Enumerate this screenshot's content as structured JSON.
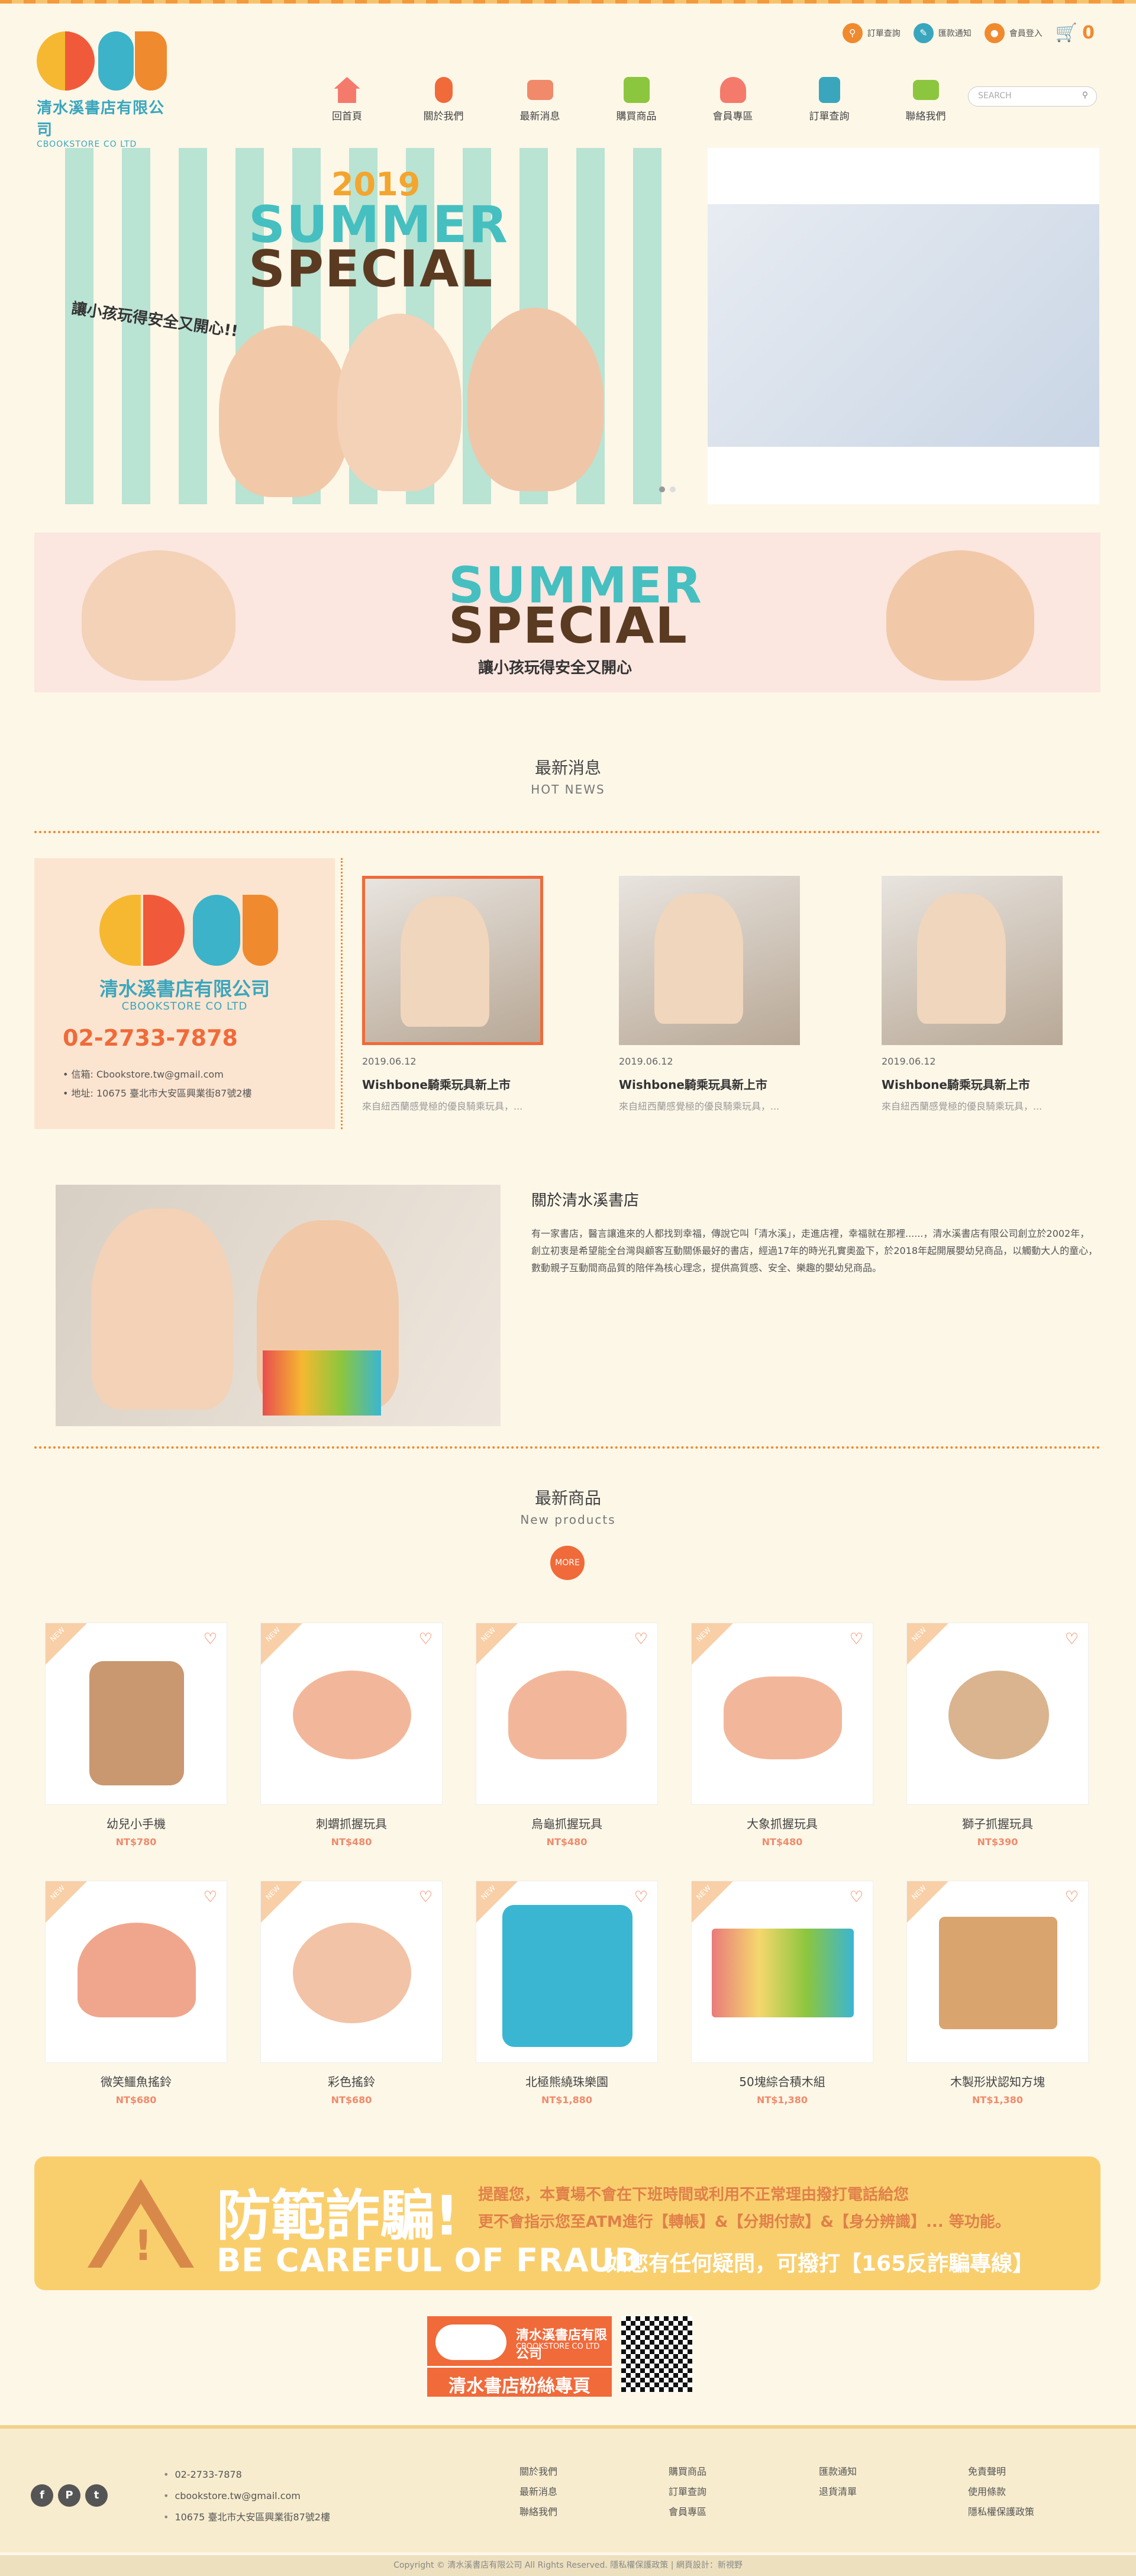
{
  "header": {
    "logo_cn": "清水溪書店有限公司",
    "logo_en": "CBOOKSTORE CO LTD",
    "utility": [
      {
        "label": "訂單查詢",
        "icon": "search-icon",
        "color": "#f08a2e"
      },
      {
        "label": "匯款通知",
        "icon": "edit-icon",
        "color": "#3aa6be"
      },
      {
        "label": "會員登入",
        "icon": "lock-icon",
        "color": "#f08a2e"
      }
    ],
    "cart_count": "0",
    "search_placeholder": "SEARCH"
  },
  "nav": [
    {
      "label": "回首頁",
      "icon": "home-icon",
      "color": "#f47a6c"
    },
    {
      "label": "關於我們",
      "icon": "about-icon",
      "color": "#f06a3a"
    },
    {
      "label": "最新消息",
      "icon": "news-icon",
      "color": "#f08a6a"
    },
    {
      "label": "購買商品",
      "icon": "shop-icon",
      "color": "#8cc63e"
    },
    {
      "label": "會員專區",
      "icon": "member-icon",
      "color": "#f47a6c"
    },
    {
      "label": "訂單查詢",
      "icon": "order-icon",
      "color": "#3aa6be"
    },
    {
      "label": "聯絡我們",
      "icon": "contact-icon",
      "color": "#8cc63e"
    }
  ],
  "hero": {
    "year": "2019",
    "title1": "SUMMER",
    "title2": "SPECIAL",
    "slogan": "讓小孩玩得安全又開心!!"
  },
  "banner2": {
    "title1": "SUMMER",
    "title2": "SPECIAL",
    "slogan": "讓小孩玩得安全又開心"
  },
  "news_section": {
    "title": "最新消息",
    "subtitle": "HOT NEWS"
  },
  "company": {
    "name": "清水溪書店有限公司",
    "en": "CBOOKSTORE CO LTD",
    "phone": "02-2733-7878",
    "email": "• 信箱: Cbookstore.tw@gmail.com",
    "address": "• 地址: 10675 臺北市大安區興業街87號2樓"
  },
  "news": [
    {
      "date": "2019.06.12",
      "title": "Wishbone騎乘玩具新上市",
      "desc": "來自紐西蘭感覺極的優良騎乘玩具，..."
    },
    {
      "date": "2019.06.12",
      "title": "Wishbone騎乘玩具新上市",
      "desc": "來自紐西蘭感覺極的優良騎乘玩具，..."
    },
    {
      "date": "2019.06.12",
      "title": "Wishbone騎乘玩具新上市",
      "desc": "來自紐西蘭感覺極的優良騎乘玩具，..."
    }
  ],
  "about": {
    "title": "關於清水溪書店",
    "text": "有一家書店，醫言讓進來的人都找到幸福，傳說它叫「清水溪」，走進店裡，幸福就在那裡......，清水溪書店有限公司創立於2002年，創立初衷是希望能全台灣與顧客互動關係最好的書店，經過17年的時光孔實奧盈下，於2018年起開展嬰幼兒商品，以觸動大人的童心，數動親子互動間商品質的陪伴為核心理念，提供高質感、安全、樂趣的嬰幼兒商品。"
  },
  "products_section": {
    "title": "最新商品",
    "subtitle": "New products",
    "more": "MORE"
  },
  "products": [
    {
      "name": "幼兒小手機",
      "price": "NT$780",
      "color": "#c99870"
    },
    {
      "name": "刺蝟抓握玩具",
      "price": "NT$480",
      "color": "#f2b79a"
    },
    {
      "name": "烏龜抓握玩具",
      "price": "NT$480",
      "color": "#f2b79a"
    },
    {
      "name": "大象抓握玩具",
      "price": "NT$480",
      "color": "#f2b79a"
    },
    {
      "name": "獅子抓握玩具",
      "price": "NT$390",
      "color": "#d9b48e"
    },
    {
      "name": "微笑鱷魚搖鈴",
      "price": "NT$680",
      "color": "#f0a68c"
    },
    {
      "name": "彩色搖鈴",
      "price": "NT$680",
      "color": "#f2c3a6"
    },
    {
      "name": "北極熊繞珠樂園",
      "price": "NT$1,880",
      "color": "#3ab6d2"
    },
    {
      "name": "50塊綜合積木組",
      "price": "NT$1,380",
      "color": "#e97b7b"
    },
    {
      "name": "木製形狀認知方塊",
      "price": "NT$1,380",
      "color": "#d9a46e"
    }
  ],
  "fraud": {
    "title": "防範詐騙!",
    "en": "BE CAREFUL OF FRAUD",
    "line1": "提醒您，本賣場不會在下班時間或利用不正常理由撥打電話給您",
    "line2": "更不會指示您至ATM進行【轉帳】&【分期付款】&【身分辨識】... 等功能。",
    "line3": "如您有任何疑問，可撥打【165反詐騙專線】"
  },
  "fanpage": {
    "name": "清水溪書店有限公司",
    "en": "CBOOKSTORE CO LTD",
    "label": "清水書店粉絲專頁"
  },
  "footer": {
    "social": [
      "f",
      "P",
      "t"
    ],
    "phone": "02-2733-7878",
    "email": "cbookstore.tw@gmail.com",
    "address": "10675 臺北市大安區興業街87號2樓",
    "col1": [
      "關於我們",
      "最新消息",
      "聯絡我們"
    ],
    "col2": [
      "購買商品",
      "訂單查詢",
      "會員專區"
    ],
    "col3": [
      "匯款通知",
      "退貨清單"
    ],
    "col4": [
      "免責聲明",
      "使用條款",
      "隱私權保護政策"
    ],
    "copyright": "Copyright © 清水溪書店有限公司 All Rights Reserved. 隱私權保護政策 | 網頁設計：新視野"
  }
}
